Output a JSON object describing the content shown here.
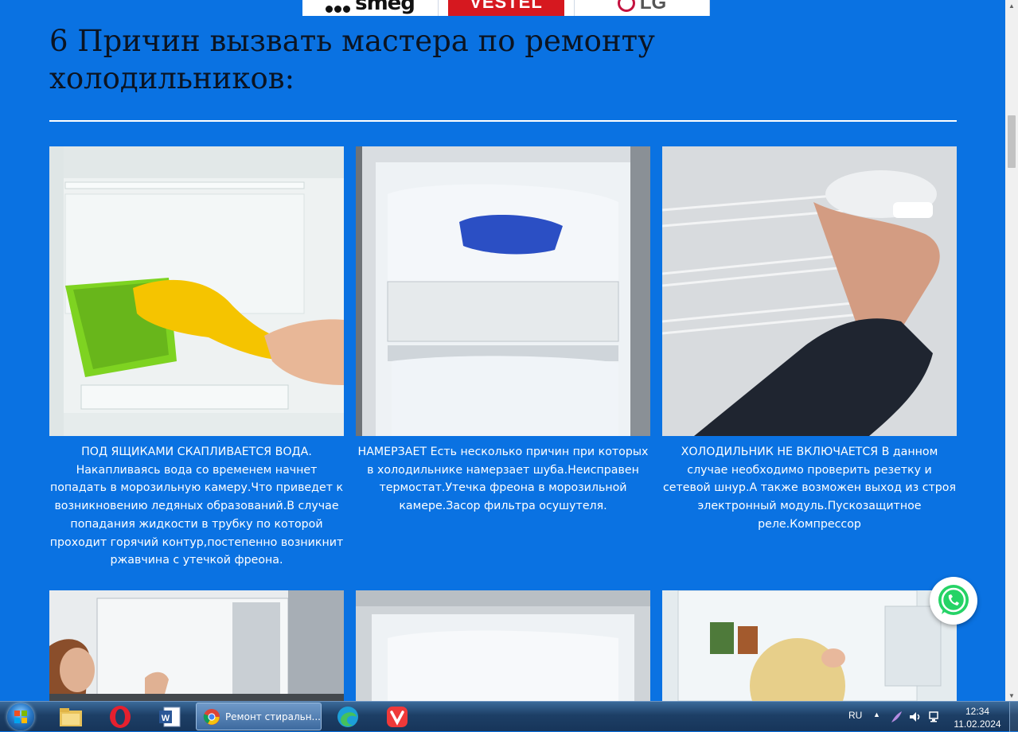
{
  "brands": [
    "smeg",
    "VESTEL",
    "LG"
  ],
  "heading": "6 Причин  вызвать мастера по ремонту холодильников:",
  "cards": [
    {
      "text": "ПОД ЯЩИКАМИ СКАПЛИВАЕТСЯ ВОДА. Накапливаясь вода со временем начнет попадать в морозильную камеру.Что приведет к возникновению ледяных образований.В случае попадания жидкости в трубку по которой проходит горячий контур,постепенно возникнит ржавчина с утечкой фреона."
    },
    {
      "text": "НАМЕРЗАЕТ Есть несколько причин при которых в холодильнике намерзает шуба.Неисправен термостат.Утечка фреона в морозильной камере.Засор фильтра осушутеля."
    },
    {
      "text": "ХОЛОДИЛЬНИК НЕ ВКЛЮЧАЕТСЯ В данном случае необходимо проверить резетку и сетевой шнур.А также возможен выход из строя электронный модуль.Пускозащитное реле.Компрессор"
    }
  ],
  "taskbar": {
    "chrome_label": "Ремонт стиральн...",
    "language": "RU",
    "time": "12:34",
    "date": "11.02.2024"
  }
}
